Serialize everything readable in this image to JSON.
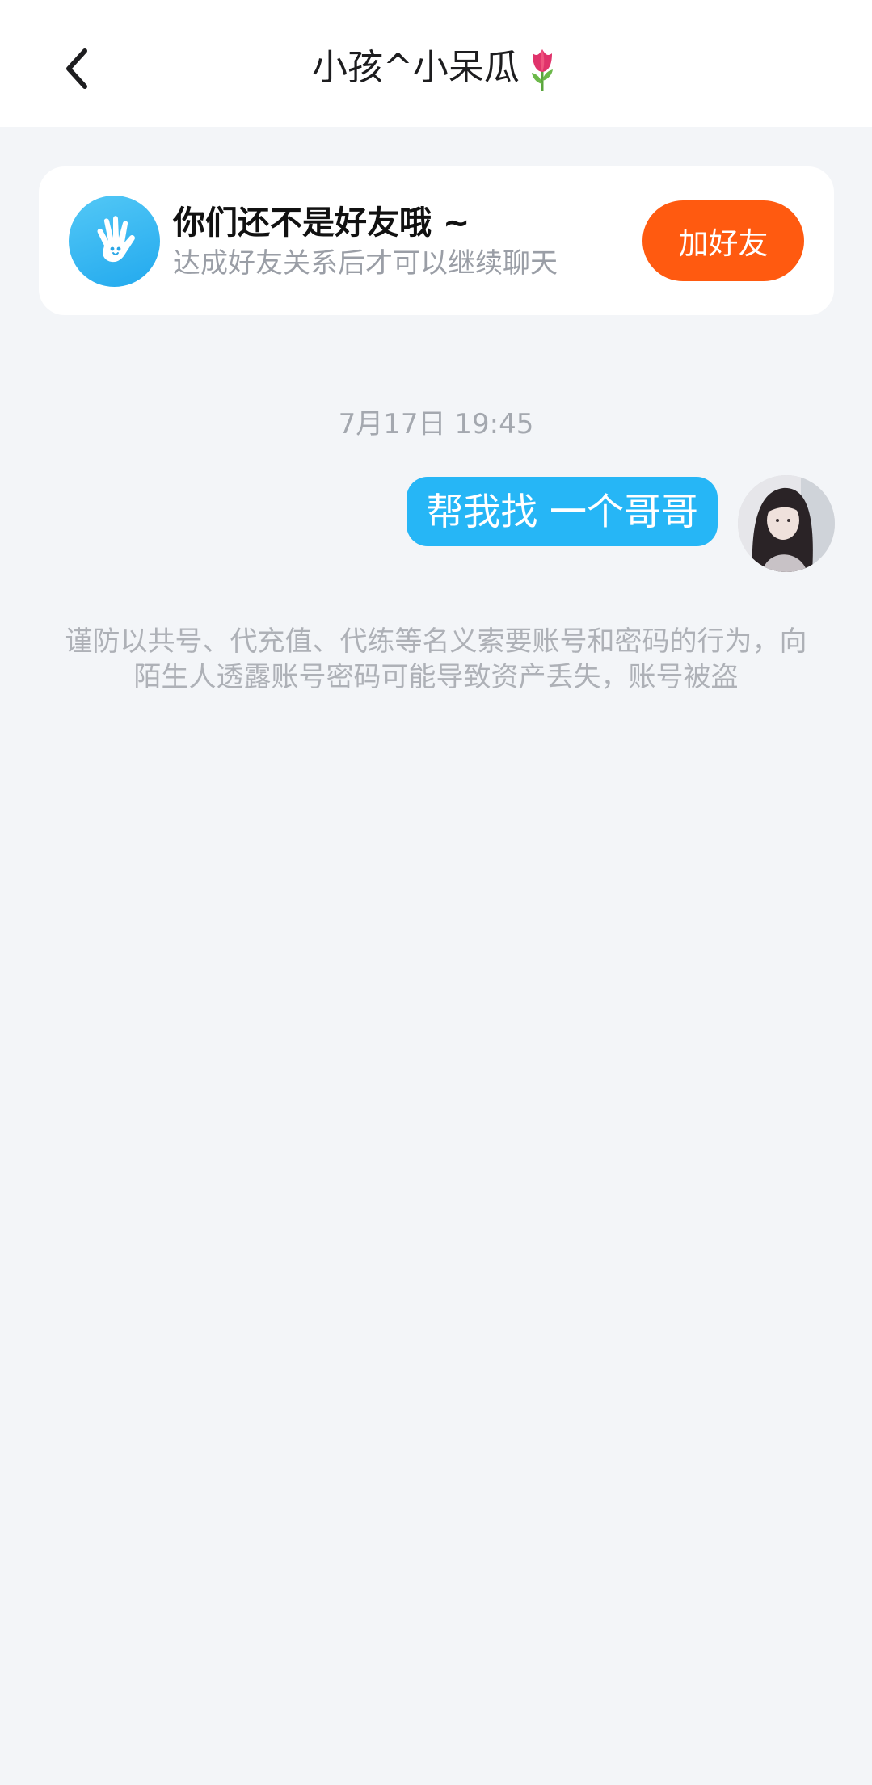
{
  "header": {
    "title": "小孩^小呆瓜",
    "title_emoji": "tulip-icon",
    "back_icon": "chevron-left-icon"
  },
  "friend_card": {
    "icon": "waving-hand-icon",
    "title": "你们还不是好友哦 ~",
    "subtitle": "达成好友关系后才可以继续聊天",
    "add_button_label": "加好友"
  },
  "chat": {
    "timestamp": "7月17日 19:45",
    "messages": [
      {
        "from": "me",
        "text": "帮我找 一个哥哥"
      }
    ]
  },
  "notice": {
    "text": "谨防以共号、代充值、代练等名义索要账号和密码的行为，向陌生人透露账号密码可能导致资产丢失，账号被盗"
  },
  "colors": {
    "background": "#f3f5f8",
    "bubble": "#26b6f6",
    "add_button": "#ff5a10",
    "hand_avatar": "#2ab0f0"
  }
}
